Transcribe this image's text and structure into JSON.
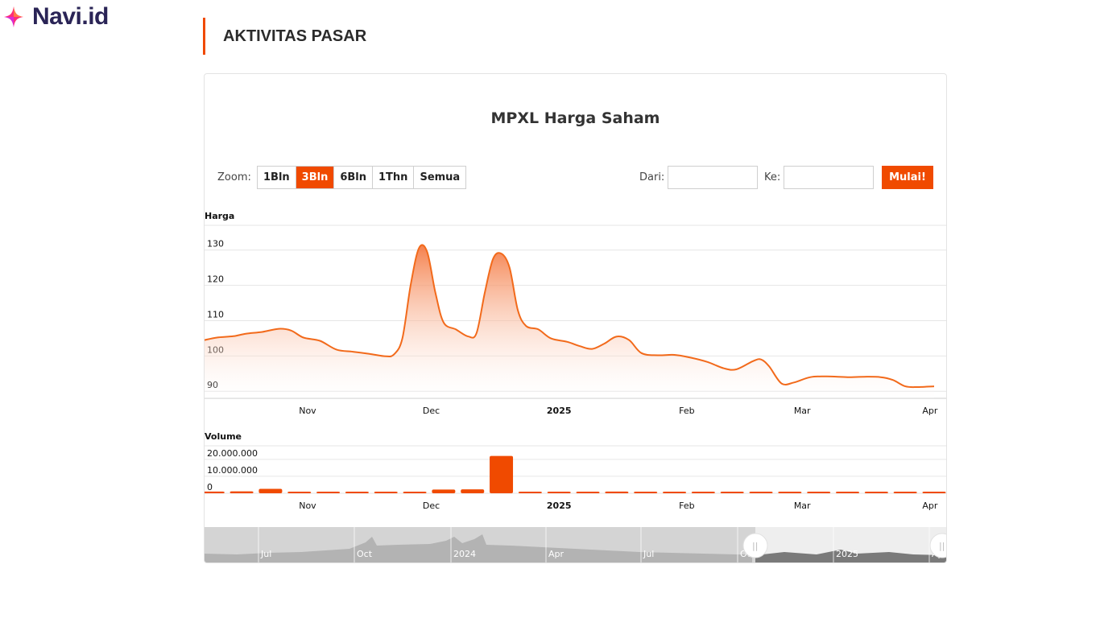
{
  "brand": {
    "name": "Navi.id",
    "accent": "#f04a00",
    "logo_color": "#2a2456"
  },
  "section": {
    "title": "AKTIVITAS PASAR"
  },
  "toolbar": {
    "zoom_label": "Zoom:",
    "zoom_options": [
      "1Bln",
      "3Bln",
      "6Bln",
      "1Thn",
      "Semua"
    ],
    "zoom_selected": "3Bln",
    "from_label": "Dari:",
    "from_value": "",
    "to_label": "Ke:",
    "to_value": "",
    "go_label": "Mulai!"
  },
  "chart_data": {
    "type": "area",
    "title": "MPXL Harga Saham",
    "price": {
      "ylabel": "Harga",
      "ylim": [
        88,
        137
      ],
      "yticks": [
        90,
        100,
        110,
        120,
        130
      ],
      "x_start": "2024-10-07",
      "x_end": "2025-04-02",
      "points": [
        [
          "2024-10-07",
          104.5
        ],
        [
          "2024-10-10",
          105.2
        ],
        [
          "2024-10-14",
          105.6
        ],
        [
          "2024-10-17",
          106.3
        ],
        [
          "2024-10-21",
          106.8
        ],
        [
          "2024-10-25",
          107.7
        ],
        [
          "2024-10-28",
          107.2
        ],
        [
          "2024-10-31",
          105.2
        ],
        [
          "2024-11-04",
          104.3
        ],
        [
          "2024-11-08",
          101.8
        ],
        [
          "2024-11-12",
          101.2
        ],
        [
          "2024-11-16",
          100.6
        ],
        [
          "2024-11-20",
          99.9
        ],
        [
          "2024-11-22",
          100.5
        ],
        [
          "2024-11-24",
          105.0
        ],
        [
          "2024-11-26",
          120.0
        ],
        [
          "2024-11-28",
          130.5
        ],
        [
          "2024-11-30",
          129.5
        ],
        [
          "2024-12-02",
          118.0
        ],
        [
          "2024-12-04",
          109.5
        ],
        [
          "2024-12-07",
          107.5
        ],
        [
          "2024-12-10",
          105.5
        ],
        [
          "2024-12-12",
          106.5
        ],
        [
          "2024-12-14",
          118.0
        ],
        [
          "2024-12-16",
          127.5
        ],
        [
          "2024-12-18",
          129.0
        ],
        [
          "2024-12-20",
          125.0
        ],
        [
          "2024-12-22",
          113.0
        ],
        [
          "2024-12-24",
          108.5
        ],
        [
          "2024-12-27",
          107.5
        ],
        [
          "2024-12-30",
          105.0
        ],
        [
          "2025-01-03",
          104.0
        ],
        [
          "2025-01-06",
          102.8
        ],
        [
          "2025-01-09",
          102.0
        ],
        [
          "2025-01-12",
          103.5
        ],
        [
          "2025-01-15",
          105.5
        ],
        [
          "2025-01-18",
          104.5
        ],
        [
          "2025-01-21",
          100.8
        ],
        [
          "2025-01-25",
          100.2
        ],
        [
          "2025-01-29",
          100.3
        ],
        [
          "2025-02-02",
          99.5
        ],
        [
          "2025-02-06",
          98.3
        ],
        [
          "2025-02-10",
          96.5
        ],
        [
          "2025-02-13",
          96.2
        ],
        [
          "2025-02-17",
          98.5
        ],
        [
          "2025-02-19",
          99.0
        ],
        [
          "2025-02-21",
          97.0
        ],
        [
          "2025-02-24",
          92.2
        ],
        [
          "2025-02-27",
          92.5
        ],
        [
          "2025-03-03",
          94.0
        ],
        [
          "2025-03-07",
          94.2
        ],
        [
          "2025-03-12",
          94.0
        ],
        [
          "2025-03-16",
          94.1
        ],
        [
          "2025-03-20",
          94.0
        ],
        [
          "2025-03-23",
          93.2
        ],
        [
          "2025-03-26",
          91.4
        ],
        [
          "2025-03-29",
          91.2
        ],
        [
          "2025-04-02",
          91.4
        ]
      ]
    },
    "volume": {
      "ylabel": "Volume",
      "ylim": [
        0,
        28000000
      ],
      "yticks": [
        0,
        10000000,
        20000000
      ],
      "ytick_labels": [
        "0",
        "10.000.000",
        "20.000.000"
      ],
      "bars": [
        [
          "2024-10-09",
          1000000
        ],
        [
          "2024-10-16",
          1100000
        ],
        [
          "2024-10-23",
          2600000
        ],
        [
          "2024-10-30",
          250000
        ],
        [
          "2024-11-06",
          200000
        ],
        [
          "2024-11-13",
          200000
        ],
        [
          "2024-11-20",
          300000
        ],
        [
          "2024-11-27",
          700000
        ],
        [
          "2024-12-04",
          2200000
        ],
        [
          "2024-12-11",
          2300000
        ],
        [
          "2024-12-18",
          22000000
        ],
        [
          "2024-12-25",
          250000
        ],
        [
          "2025-01-01",
          600000
        ],
        [
          "2025-01-08",
          250000
        ],
        [
          "2025-01-15",
          1000000
        ],
        [
          "2025-01-22",
          300000
        ],
        [
          "2025-01-29",
          250000
        ],
        [
          "2025-02-05",
          700000
        ],
        [
          "2025-02-12",
          250000
        ],
        [
          "2025-02-19",
          250000
        ],
        [
          "2025-02-26",
          250000
        ],
        [
          "2025-03-05",
          250000
        ],
        [
          "2025-03-12",
          250000
        ],
        [
          "2025-03-19",
          250000
        ],
        [
          "2025-03-26",
          250000
        ],
        [
          "2025-04-02",
          250000
        ]
      ]
    },
    "xticks": [
      {
        "date": "2024-11-01",
        "label": "Nov",
        "bold": false
      },
      {
        "date": "2024-12-01",
        "label": "Dec",
        "bold": false
      },
      {
        "date": "2025-01-01",
        "label": "2025",
        "bold": true
      },
      {
        "date": "2025-02-01",
        "label": "Feb",
        "bold": false
      },
      {
        "date": "2025-03-01",
        "label": "Mar",
        "bold": false
      },
      {
        "date": "2025-04-01",
        "label": "Apr",
        "bold": false
      }
    ],
    "navigator": {
      "labels": [
        "Jul",
        "Oct",
        "2024",
        "Apr",
        "Jul",
        "Oct",
        "2025",
        "Apr"
      ],
      "selected_range": "3Bln"
    },
    "colors": {
      "line": "#f26a1b",
      "fill_top": "#f47a43",
      "bar": "#f04a00",
      "grid": "#e6e6e6"
    },
    "grid": true,
    "legend": "none"
  }
}
